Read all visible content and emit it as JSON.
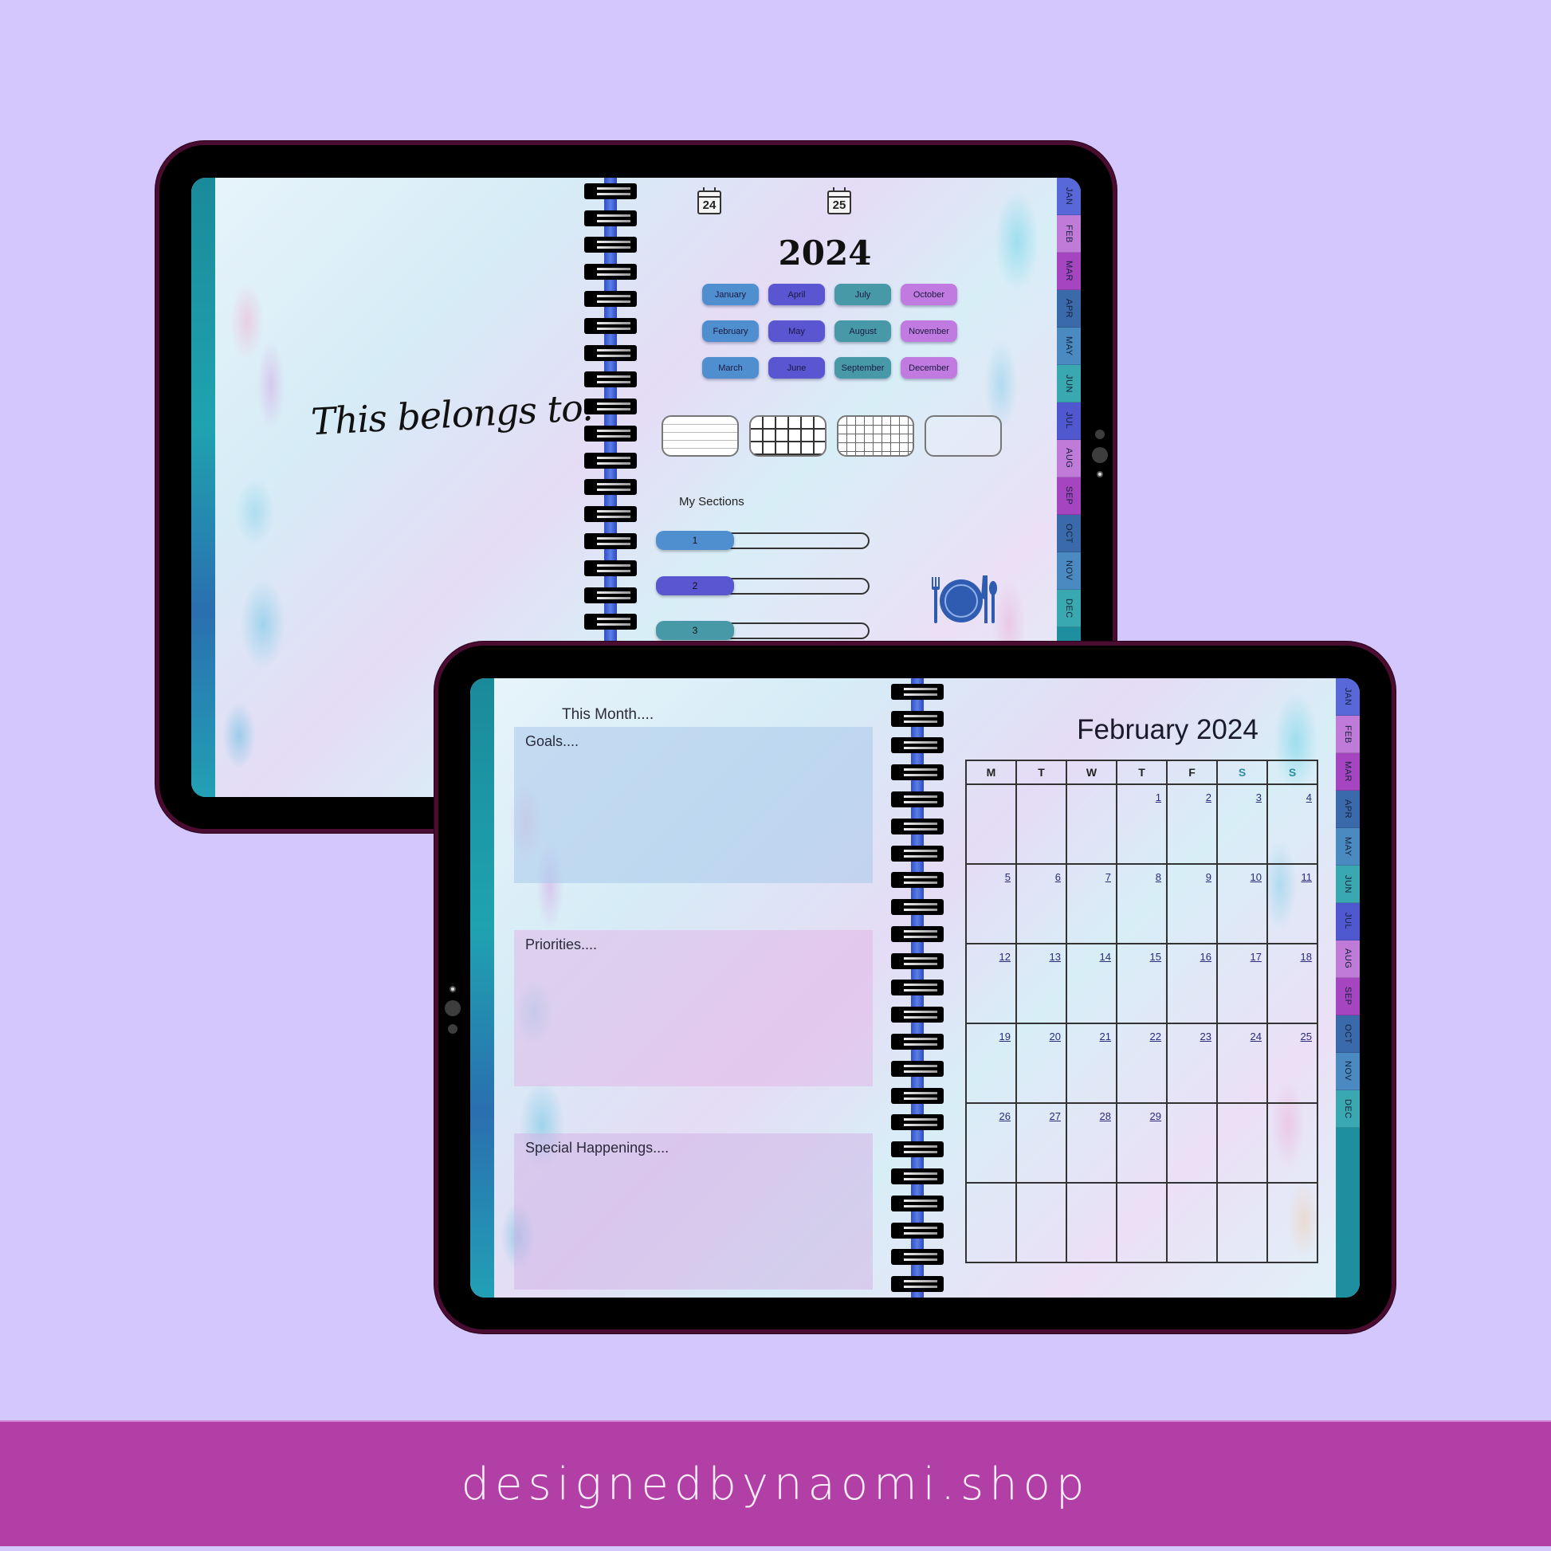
{
  "colors": {
    "background": "#d4c7fd",
    "footer": "#b23fa6",
    "frame": "#4a0c30",
    "month_col_1": "#4f8fd0",
    "month_col_2": "#5a55d0",
    "month_col_3": "#4899a8",
    "month_col_4": "#c07ae0",
    "section_1": "#4f8fd0",
    "section_2": "#5a55d0",
    "section_3": "#4899a8",
    "weekend_header": "#2e8ea0",
    "dining_icon": "#2f5bb0"
  },
  "month_tabs": [
    "JAN",
    "FEB",
    "MAR",
    "APR",
    "MAY",
    "JUN",
    "JUL",
    "AUG",
    "SEP",
    "OCT",
    "NOV",
    "DEC"
  ],
  "top_tablet": {
    "left_page": {
      "title": "This belongs to:"
    },
    "right_page": {
      "year_icons": [
        "24",
        "25"
      ],
      "year_title": "2024",
      "months": [
        {
          "label": "January",
          "col": 1
        },
        {
          "label": "April",
          "col": 2
        },
        {
          "label": "July",
          "col": 3
        },
        {
          "label": "October",
          "col": 4
        },
        {
          "label": "February",
          "col": 1
        },
        {
          "label": "May",
          "col": 2
        },
        {
          "label": "August",
          "col": 3
        },
        {
          "label": "November",
          "col": 4
        },
        {
          "label": "March",
          "col": 1
        },
        {
          "label": "June",
          "col": 2
        },
        {
          "label": "September",
          "col": 3
        },
        {
          "label": "December",
          "col": 4
        }
      ],
      "templates": [
        {
          "type": "lined",
          "icon": "lined-paper-icon"
        },
        {
          "type": "grid",
          "icon": "grid-paper-icon"
        },
        {
          "type": "fine-grid",
          "icon": "fine-grid-paper-icon"
        },
        {
          "type": "blank",
          "icon": "blank-paper-icon"
        }
      ],
      "sections_label": "My Sections",
      "sections": [
        {
          "label": "1"
        },
        {
          "label": "2"
        },
        {
          "label": "3"
        }
      ],
      "dining_icon": "plate-fork-knife-icon"
    }
  },
  "bottom_tablet": {
    "left_page": {
      "heading": "This Month....",
      "boxes": [
        {
          "label": "Goals...."
        },
        {
          "label": "Priorities...."
        },
        {
          "label": "Special Happenings...."
        }
      ]
    },
    "right_page": {
      "title": "February 2024",
      "weekdays": [
        "M",
        "T",
        "W",
        "T",
        "F",
        "S",
        "S"
      ],
      "weeks": [
        [
          "",
          "",
          "",
          "1",
          "2",
          "3",
          "4"
        ],
        [
          "5",
          "6",
          "7",
          "8",
          "9",
          "10",
          "11"
        ],
        [
          "12",
          "13",
          "14",
          "15",
          "16",
          "17",
          "18"
        ],
        [
          "19",
          "20",
          "21",
          "22",
          "23",
          "24",
          "25"
        ],
        [
          "26",
          "27",
          "28",
          "29",
          "",
          "",
          ""
        ],
        [
          "",
          "",
          "",
          "",
          "",
          "",
          ""
        ]
      ]
    }
  },
  "footer": {
    "text": "designedbynaomi.shop"
  }
}
